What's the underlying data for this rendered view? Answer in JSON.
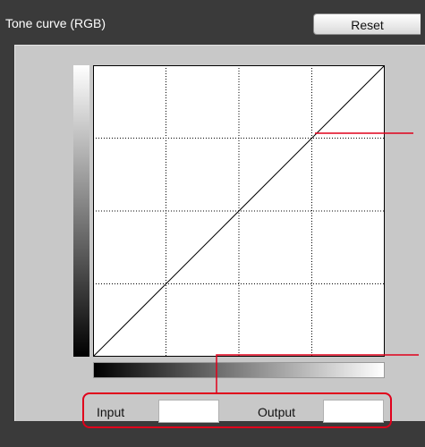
{
  "window": {
    "title": "Tone curve (RGB)"
  },
  "toolbar": {
    "reset_label": "Reset"
  },
  "io": {
    "input_label": "Input",
    "input_value": "",
    "output_label": "Output",
    "output_value": ""
  },
  "colors": {
    "panel_bg": "#3a3a3a",
    "work_bg": "#c8c8c8",
    "callout": "#e0001b"
  }
}
